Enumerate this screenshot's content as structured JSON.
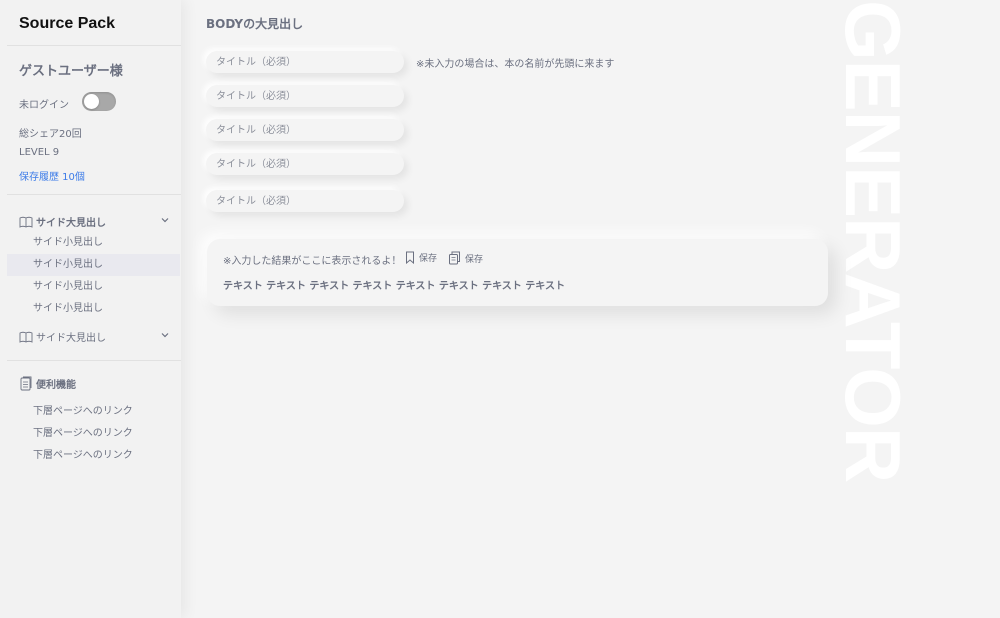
{
  "sidebar": {
    "brand": "Source Pack",
    "user": "ゲストユーザー様",
    "login_status": "未ログイン",
    "login_toggle_on": false,
    "share_count": "総シェア20回",
    "level": "LEVEL 9",
    "history": "保存履歴 10個",
    "groups": [
      {
        "label": "サイド大見出し",
        "icon": "book-icon",
        "expanded": true,
        "items": [
          "サイド小見出し",
          "サイド小見出し",
          "サイド小見出し",
          "サイド小見出し"
        ],
        "active_index": 1
      },
      {
        "label": "サイド大見出し",
        "icon": "book-icon",
        "expanded": false,
        "items": []
      }
    ],
    "utilities": {
      "label": "便利機能",
      "icon": "document-icon",
      "links": [
        "下層ページへのリンク",
        "下層ページへのリンク",
        "下層ページへのリンク"
      ]
    }
  },
  "main": {
    "title": "BODYの大見出し",
    "inputs": [
      {
        "placeholder": "タイトル（必須）",
        "value": ""
      },
      {
        "placeholder": "タイトル（必須）",
        "value": ""
      },
      {
        "placeholder": "タイトル（必須）",
        "value": ""
      },
      {
        "placeholder": "タイトル（必須）",
        "value": ""
      },
      {
        "placeholder": "タイトル（必須）",
        "value": ""
      }
    ],
    "note": "※未入力の場合は、本の名前が先頭に来ます",
    "result": {
      "message": "※入力した結果がここに表示されるよ！",
      "bookmark_label": "保存",
      "copy_label": "保存",
      "text": "テキスト テキスト テキスト テキスト テキスト テキスト テキスト テキスト"
    },
    "watermark": "GENERATOR"
  },
  "colors": {
    "background": "#f4f4f4",
    "text": "#6b7080",
    "accent": "#3d7ce8",
    "toggle_off": "#a8a8a8"
  }
}
